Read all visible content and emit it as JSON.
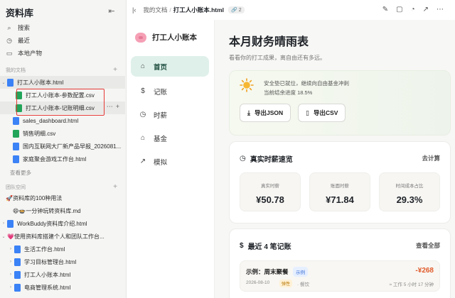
{
  "sidebar": {
    "title": "资料库",
    "nav": [
      {
        "label": "搜索",
        "icon": "search-icon"
      },
      {
        "label": "最近",
        "icon": "clock-icon"
      },
      {
        "label": "本地产物",
        "icon": "folder-icon"
      }
    ],
    "my_docs_label": "我的文档",
    "my_docs": [
      {
        "label": "打工人小账本.html",
        "icon": "html-file-icon"
      },
      {
        "label": "打工人小账本-参数配置.csv",
        "icon": "csv-file-icon"
      },
      {
        "label": "打工人小账本-记账明细.csv",
        "icon": "csv-file-icon"
      },
      {
        "label": "sales_dashboard.html",
        "icon": "html-file-icon"
      },
      {
        "label": "销售明细.csv",
        "icon": "csv-file-icon"
      },
      {
        "label": "国内互联网大厂新产品早报_2026081...",
        "icon": "html-file-icon"
      },
      {
        "label": "家庭聚会游戏工作台.html",
        "icon": "html-file-icon"
      }
    ],
    "see_more": "查看更多",
    "team_label": "团队空间",
    "team": [
      {
        "label": "🚀资料库的100种用法",
        "icon": "rocket-icon"
      },
      {
        "label": "😄🍲一分钟玩转资料库.md",
        "icon": "md-file-icon"
      },
      {
        "label": "WorkBuddy资料库介绍.html",
        "icon": "html-file-icon"
      },
      {
        "label": "💗使用资料库搭建个人和团队工作台...",
        "icon": "folder-icon"
      },
      {
        "label": "生活工作台.html",
        "icon": "html-file-icon"
      },
      {
        "label": "学习目标管理台.html",
        "icon": "html-file-icon"
      },
      {
        "label": "打工人小账本.html",
        "icon": "html-file-icon"
      },
      {
        "label": "电商管理系统.html",
        "icon": "html-file-icon"
      }
    ]
  },
  "topbar": {
    "crumb": "我的文档",
    "current": "打工人小账本.html",
    "badge": "2"
  },
  "app": {
    "brand": "打工人小账本",
    "nav": [
      {
        "label": "首页",
        "icon": "home-icon"
      },
      {
        "label": "记账",
        "icon": "currency-icon"
      },
      {
        "label": "时薪",
        "icon": "clock-icon"
      },
      {
        "label": "基金",
        "icon": "bank-icon"
      },
      {
        "label": "模拟",
        "icon": "chart-icon"
      }
    ]
  },
  "main": {
    "title": "本月财务晴雨表",
    "subtitle": "看看你的打工成果，离自由还有多远。",
    "hero": {
      "line1": "安全垫已就位，继续向自由基金冲刺",
      "line2": "当前结余进度 18.5%",
      "export_json": "导出JSON",
      "export_csv": "导出CSV"
    },
    "rate": {
      "title": "真实时薪速览",
      "link": "去计算",
      "stats": [
        {
          "label": "真实时薪",
          "value": "¥50.78"
        },
        {
          "label": "账面时薪",
          "value": "¥71.84"
        },
        {
          "label": "时间成本占比",
          "value": "29.3%"
        }
      ]
    },
    "recent": {
      "title": "最近 4 笔记账",
      "link": "查看全部",
      "item": {
        "title": "示例：周末聚餐",
        "tag": "示例",
        "date": "2026-08-10",
        "category": "弹性",
        "sub": "· 餐饮",
        "amount": "-¥268",
        "hint": "≈ 工作 5 小时 17 分钟"
      }
    }
  },
  "colors": {
    "accent_green": "#dff0ea",
    "highlight_red": "#e53935",
    "amount_orange": "#e05a2a"
  }
}
